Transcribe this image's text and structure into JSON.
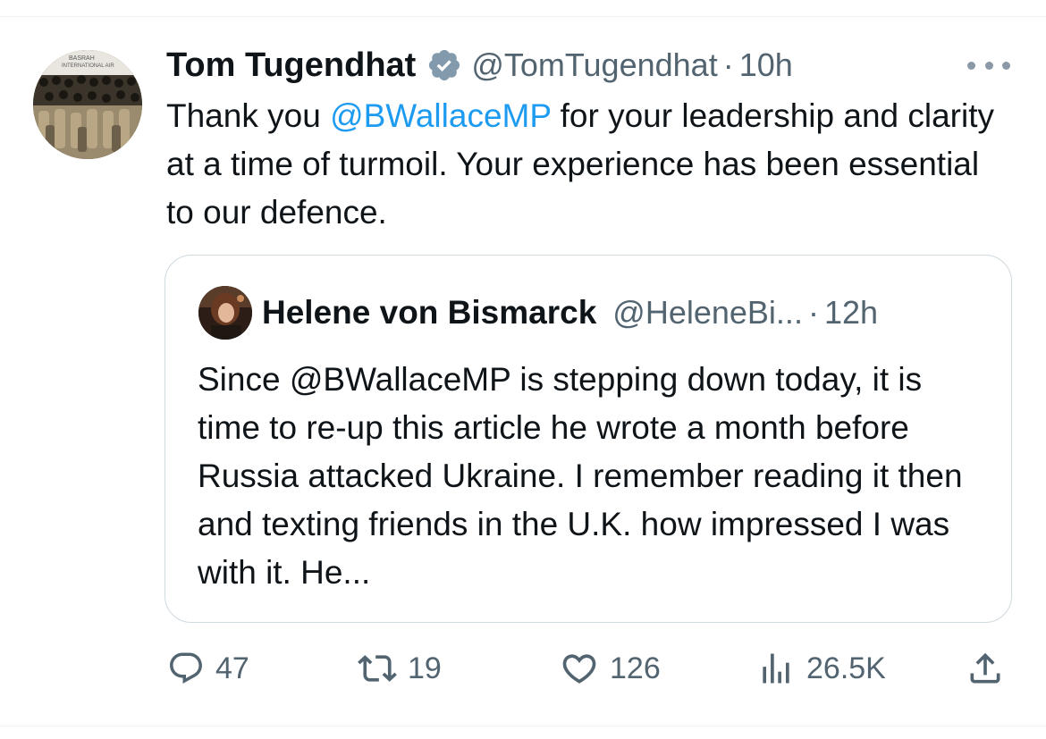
{
  "tweet": {
    "author": {
      "display_name": "Tom Tugendhat",
      "handle": "@TomTugendhat",
      "verified": true,
      "avatar_icon": "basrah-airport-avatar"
    },
    "separator": "·",
    "time": "10h",
    "more_icon": "more-horizontal-icon",
    "text": {
      "before": "Thank you ",
      "mention": "@BWallaceMP",
      "after": " for your leadership and clarity at a time of turmoil. Your experience has been essential to our defence."
    },
    "quoted": {
      "display_name": "Helene von Bismarck",
      "handle": "@HeleneBi...",
      "separator": "·",
      "time": "12h",
      "text": "Since @BWallaceMP is stepping down today, it is time to re-up this article he wrote a month before Russia attacked Ukraine. I remember reading it then and texting friends in the U.K. how impressed I was with it. He..."
    },
    "actions": {
      "replies": "47",
      "retweets": "19",
      "likes": "126",
      "views": "26.5K"
    }
  },
  "colors": {
    "text_primary": "#0f1419",
    "text_secondary": "#536471",
    "link": "#1d9bf0",
    "verified_badge": "#829aab",
    "border": "#cfd9de"
  }
}
